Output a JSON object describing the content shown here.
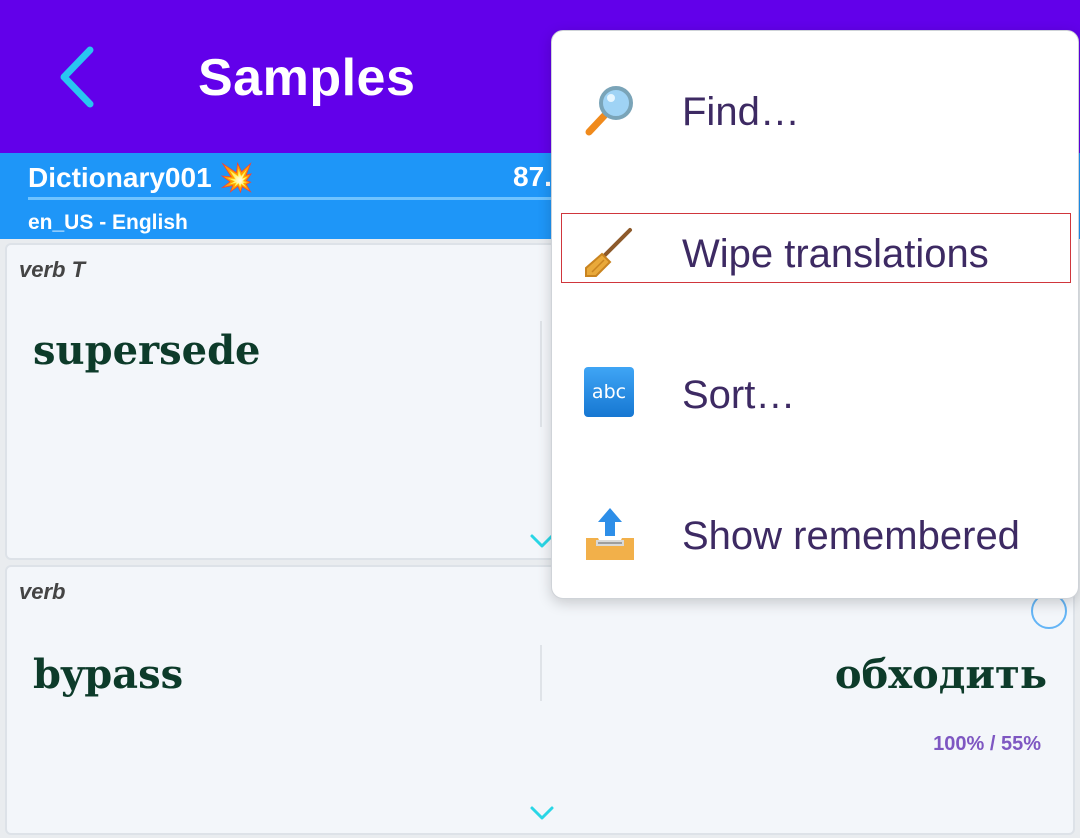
{
  "appbar": {
    "title": "Samples",
    "back_icon": "chevron-left-icon"
  },
  "dictionary": {
    "name": "Dictionary001 💥",
    "count_partial": "87.",
    "language": "en_US - English"
  },
  "cards": [
    {
      "pos": "verb T",
      "word": "supersede",
      "translation": "",
      "progress": ""
    },
    {
      "pos": "verb",
      "word": "bypass",
      "translation": "обходить",
      "progress": "100% / 55%"
    }
  ],
  "menu": {
    "items": [
      {
        "label": "Find…",
        "icon": "magnifier-icon"
      },
      {
        "label": "Wipe translations",
        "icon": "broom-icon"
      },
      {
        "label": "Sort…",
        "icon": "abc-icon"
      },
      {
        "label": "Show remembered",
        "icon": "outbox-tray-icon"
      }
    ],
    "abc_text": "abc"
  },
  "colors": {
    "appbar": "#6200ea",
    "dictbar": "#1e96f8",
    "accent_chevron": "#29d6e6",
    "menu_text": "#3d2a63",
    "highlight": "#d0363c"
  }
}
